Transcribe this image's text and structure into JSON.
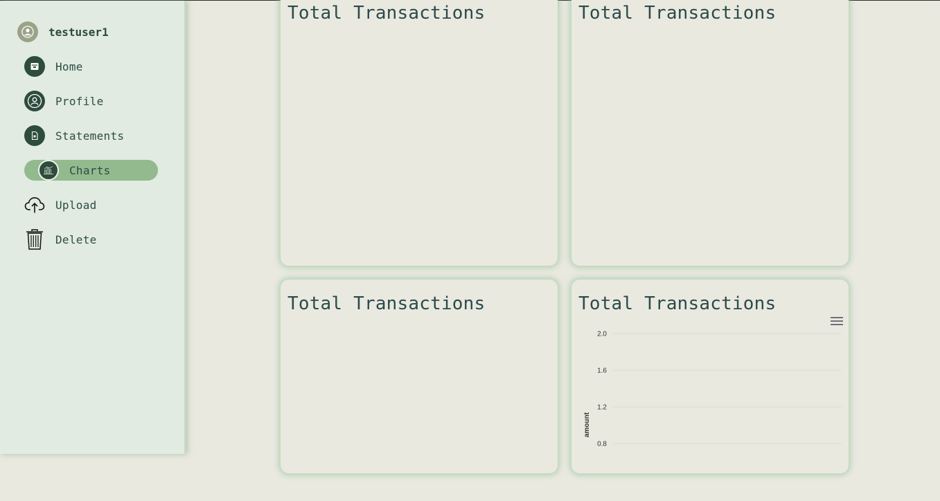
{
  "user": {
    "name": "testuser1"
  },
  "nav": {
    "items": [
      {
        "label": "Home",
        "icon": "home-icon"
      },
      {
        "label": "Profile",
        "icon": "profile-icon"
      },
      {
        "label": "Statements",
        "icon": "statements-icon"
      },
      {
        "label": "Charts",
        "icon": "charts-icon",
        "active": true
      },
      {
        "label": "Upload",
        "icon": "upload-icon"
      },
      {
        "label": "Delete",
        "icon": "trash-icon"
      }
    ]
  },
  "cards": [
    {
      "title": "Total Transactions"
    },
    {
      "title": "Total Transactions"
    },
    {
      "title": "Total Transactions"
    },
    {
      "title": "Total Transactions"
    }
  ],
  "chart_data": {
    "type": "line",
    "title": "Total Transactions",
    "ylabel": "amount",
    "xlabel": "",
    "yticks": [
      "2.0",
      "1.6",
      "1.2",
      "0.8"
    ],
    "ylim": [
      0.8,
      2.0
    ],
    "grid": true,
    "series": []
  },
  "colors": {
    "sidebar_bg": "#e1ebe1",
    "accent": "#92ba8e",
    "icon_bg": "#2d4c3d",
    "page_bg": "#e9e9e0"
  }
}
